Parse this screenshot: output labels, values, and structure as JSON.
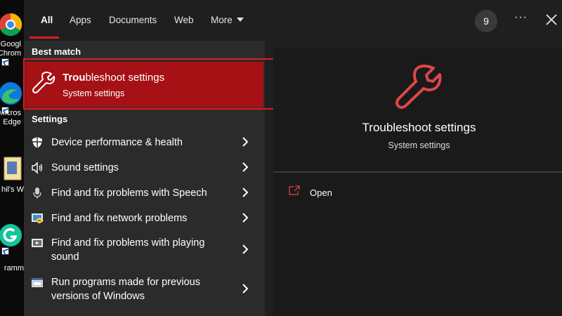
{
  "desktop": {
    "icons": [
      {
        "name": "chrome",
        "label": "Googl Chrom"
      },
      {
        "name": "edge",
        "label": "Micros Edge"
      },
      {
        "name": "file",
        "label": "hil's W"
      },
      {
        "name": "grammarly",
        "label": "ramm"
      }
    ]
  },
  "tabs": [
    {
      "label": "All",
      "active": true
    },
    {
      "label": "Apps"
    },
    {
      "label": "Documents"
    },
    {
      "label": "Web"
    },
    {
      "label": "More"
    }
  ],
  "top_right": {
    "badge": "9",
    "more_label": "···"
  },
  "best_match": {
    "heading": "Best match",
    "title_bold": "Trou",
    "title_rest": "bleshoot settings",
    "subtitle": "System settings"
  },
  "settings": {
    "heading": "Settings",
    "items": [
      {
        "icon": "shield-icon",
        "label": "Device performance & health"
      },
      {
        "icon": "speaker-icon",
        "label": "Sound settings"
      },
      {
        "icon": "microphone-icon",
        "label": "Find and fix problems with Speech"
      },
      {
        "icon": "network-troubleshoot-icon",
        "label": "Find and fix network problems"
      },
      {
        "icon": "media-troubleshoot-icon",
        "label_line1": "Find and fix problems with playing",
        "label_line2": "sound"
      },
      {
        "icon": "compatibility-icon",
        "label_line1": "Run programs made for previous",
        "label_line2": "versions of Windows"
      }
    ]
  },
  "preview": {
    "title": "Troubleshoot settings",
    "subtitle": "System settings",
    "action_label": "Open"
  },
  "colors": {
    "accent": "#e01b24",
    "selection": "#a51115",
    "pane": "#2b2b2b"
  }
}
